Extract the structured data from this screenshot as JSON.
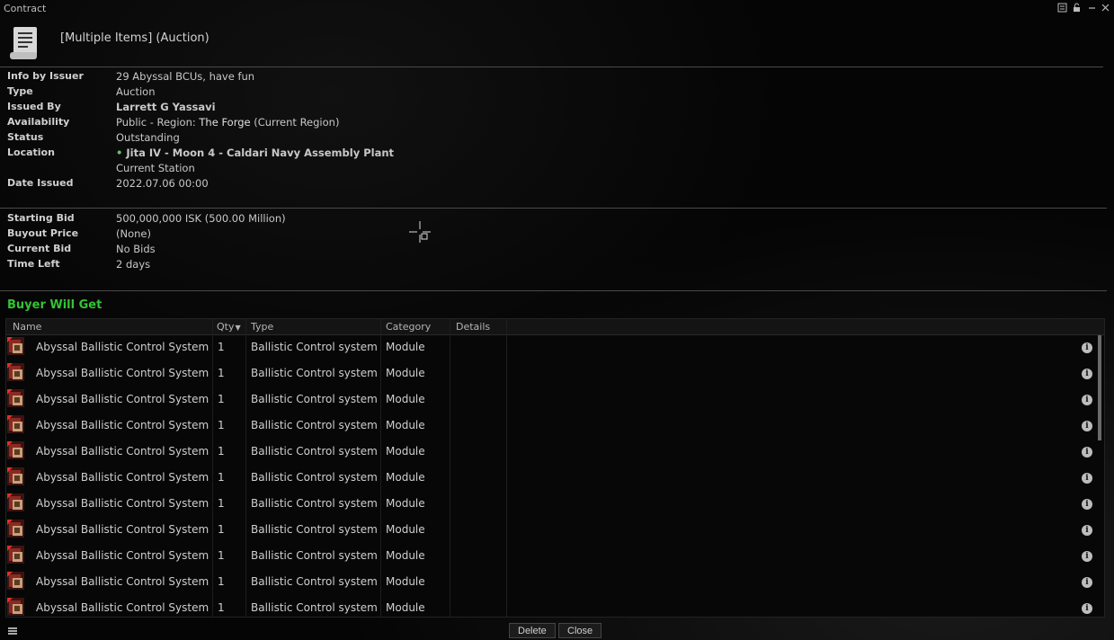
{
  "window": {
    "title": "Contract",
    "controls": [
      "minimize-icon",
      "lock-icon",
      "compact-icon",
      "close-icon"
    ]
  },
  "header": {
    "title": "[Multiple Items]  (Auction)"
  },
  "info": {
    "info_by_issuer": {
      "label": "Info by Issuer",
      "value": "29 Abyssal BCUs, have fun"
    },
    "type": {
      "label": "Type",
      "value": "Auction"
    },
    "issued_by": {
      "label": "Issued By",
      "value": "Larrett G Yassavi"
    },
    "availability": {
      "label": "Availability",
      "prefix": "Public - Region: ",
      "region": "The Forge",
      "suffix": " (Current Region)"
    },
    "status": {
      "label": "Status",
      "value": "Outstanding"
    },
    "location": {
      "label": "Location",
      "value": "Jita IV - Moon 4 - Caldari Navy Assembly Plant",
      "sub": "Current Station"
    },
    "date_issued": {
      "label": "Date Issued",
      "value": "2022.07.06 00:00"
    }
  },
  "bids": {
    "starting_bid": {
      "label": "Starting Bid",
      "value": "500,000,000 ISK (500.00 Million)"
    },
    "buyout_price": {
      "label": "Buyout Price",
      "value": "(None)"
    },
    "current_bid": {
      "label": "Current Bid",
      "value": "No Bids"
    },
    "time_left": {
      "label": "Time Left",
      "value": "2 days"
    }
  },
  "items_section": {
    "title": "Buyer Will Get",
    "columns": {
      "name": "Name",
      "qty": "Qty",
      "type": "Type",
      "category": "Category",
      "details": "Details"
    },
    "rows": [
      {
        "name": "Abyssal Ballistic Control System",
        "qty": "1",
        "type": "Ballistic Control system",
        "category": "Module"
      },
      {
        "name": "Abyssal Ballistic Control System",
        "qty": "1",
        "type": "Ballistic Control system",
        "category": "Module"
      },
      {
        "name": "Abyssal Ballistic Control System",
        "qty": "1",
        "type": "Ballistic Control system",
        "category": "Module"
      },
      {
        "name": "Abyssal Ballistic Control System",
        "qty": "1",
        "type": "Ballistic Control system",
        "category": "Module"
      },
      {
        "name": "Abyssal Ballistic Control System",
        "qty": "1",
        "type": "Ballistic Control system",
        "category": "Module"
      },
      {
        "name": "Abyssal Ballistic Control System",
        "qty": "1",
        "type": "Ballistic Control system",
        "category": "Module"
      },
      {
        "name": "Abyssal Ballistic Control System",
        "qty": "1",
        "type": "Ballistic Control system",
        "category": "Module"
      },
      {
        "name": "Abyssal Ballistic Control System",
        "qty": "1",
        "type": "Ballistic Control system",
        "category": "Module"
      },
      {
        "name": "Abyssal Ballistic Control System",
        "qty": "1",
        "type": "Ballistic Control system",
        "category": "Module"
      },
      {
        "name": "Abyssal Ballistic Control System",
        "qty": "1",
        "type": "Ballistic Control system",
        "category": "Module"
      },
      {
        "name": "Abyssal Ballistic Control System",
        "qty": "1",
        "type": "Ballistic Control system",
        "category": "Module"
      }
    ],
    "info_glyph": "i"
  },
  "footer": {
    "delete_label": "Delete",
    "close_label": "Close"
  }
}
